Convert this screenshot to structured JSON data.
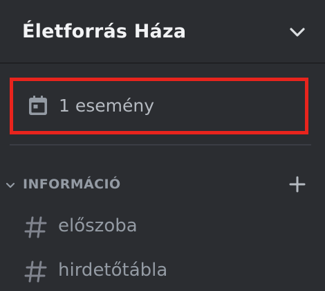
{
  "server": {
    "name": "Életforrás Háza",
    "menu_icon": "chevron-down-icon"
  },
  "events": {
    "label": "1 esemény",
    "icon": "calendar-icon",
    "highlight_color": "#e8241d"
  },
  "category": {
    "label": "INFORMÁCIÓ",
    "collapse_icon": "chevron-down-icon",
    "add_icon": "plus-icon"
  },
  "channels": [
    {
      "name": "előszoba",
      "icon": "hash-icon"
    },
    {
      "name": "hirdetőtábla",
      "icon": "hash-icon"
    }
  ],
  "colors": {
    "background": "#2b2d31",
    "header_text": "#f2f3f5",
    "muted_text": "#949ba4",
    "event_text": "#b5bac1"
  }
}
